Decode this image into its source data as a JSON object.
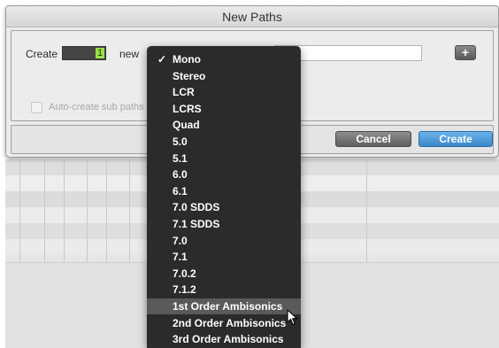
{
  "dialog": {
    "title": "New Paths",
    "create_label": "Create",
    "count_value": "1",
    "new_label": "new",
    "auto_create_label": "Auto-create sub paths",
    "add_label": "+",
    "cancel_label": "Cancel",
    "create_button_label": "Create"
  },
  "format_menu": {
    "selected": "Mono",
    "highlighted": "1st Order Ambisonics",
    "items": [
      "Mono",
      "Stereo",
      "LCR",
      "LCRS",
      "Quad",
      "5.0",
      "5.1",
      "6.0",
      "6.1",
      "7.0 SDDS",
      "7.1 SDDS",
      "7.0",
      "7.1",
      "7.0.2",
      "7.1.2",
      "1st Order Ambisonics",
      "2nd Order Ambisonics",
      "3rd Order Ambisonics"
    ]
  },
  "colors": {
    "menu_bg": "#2b2b2b",
    "menu_highlight": "#5a5a5a",
    "count_accent": "#9ae04a",
    "create_button": "#3b86c9"
  }
}
